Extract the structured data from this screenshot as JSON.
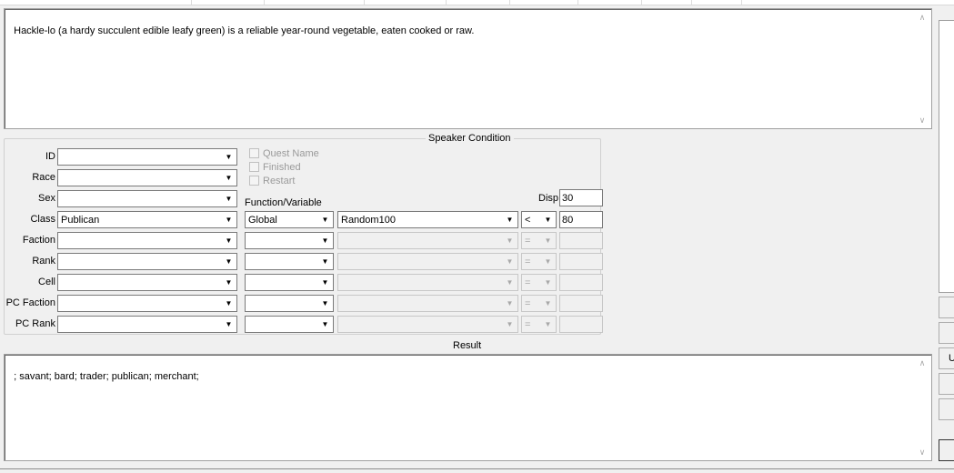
{
  "response_text": "Hackle-lo (a hardy succulent edible leafy green) is a reliable year-round vegetable, eaten cooked or raw.",
  "speaker_condition": {
    "title": "Speaker Condition",
    "labels": {
      "id": "ID",
      "race": "Race",
      "sex": "Sex",
      "class": "Class",
      "faction": "Faction",
      "rank": "Rank",
      "cell": "Cell",
      "pc_faction": "PC Faction",
      "pc_rank": "PC Rank"
    },
    "values": {
      "id": "",
      "race": "",
      "sex": "",
      "class": "Publican",
      "faction": "",
      "rank": "",
      "cell": "",
      "pc_faction": "",
      "pc_rank": ""
    },
    "checkboxes": [
      {
        "label": "Quest Name",
        "checked": false
      },
      {
        "label": "Finished",
        "checked": false
      },
      {
        "label": "Restart",
        "checked": false
      }
    ],
    "function_variable_label": "Function/Variable",
    "disp_label": "Disp",
    "disp_value": "30",
    "func_rows": [
      {
        "type": "Global",
        "variable": "Random100",
        "operator": "<",
        "value": "80"
      },
      {
        "type": "",
        "variable": "",
        "operator": "=",
        "value": ""
      },
      {
        "type": "",
        "variable": "",
        "operator": "=",
        "value": ""
      },
      {
        "type": "",
        "variable": "",
        "operator": "=",
        "value": ""
      },
      {
        "type": "",
        "variable": "",
        "operator": "=",
        "value": ""
      },
      {
        "type": "",
        "variable": "",
        "operator": "=",
        "value": ""
      }
    ]
  },
  "result": {
    "title": "Result",
    "text": "; savant; bard; trader; publican; merchant;"
  },
  "right_panel": {
    "button_partial_label": "U"
  }
}
